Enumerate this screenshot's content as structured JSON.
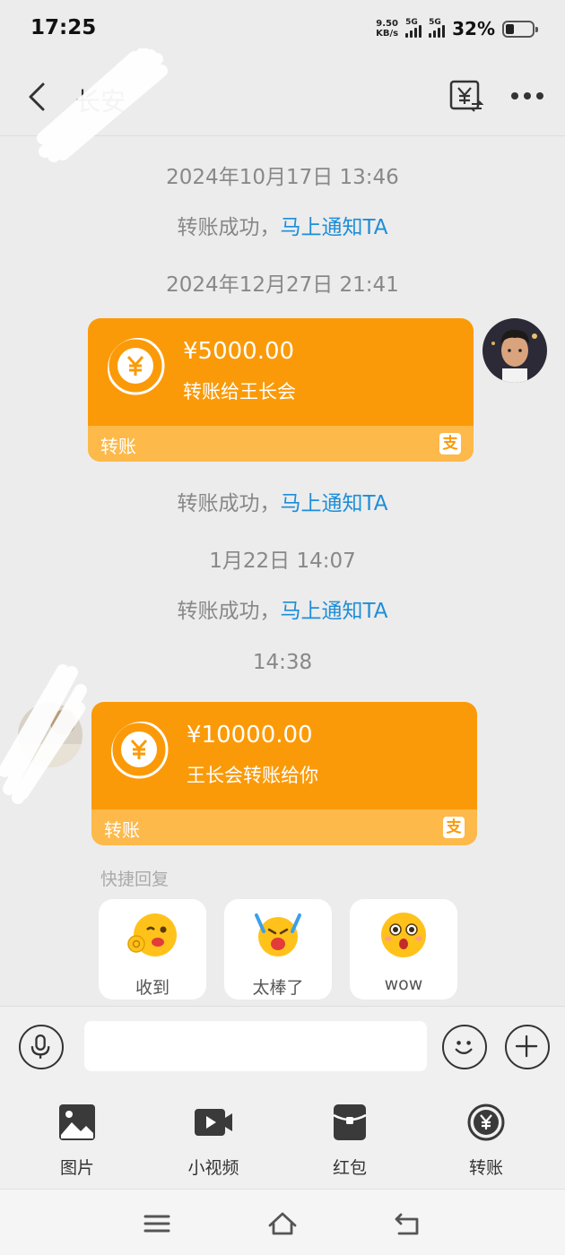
{
  "status_bar": {
    "time": "17:25",
    "net_speed_value": "9.50",
    "net_speed_unit": "KB/s",
    "sim1_label": "5G",
    "sim2_label": "5G",
    "battery_percent": "32%"
  },
  "header": {
    "contact_name": "长安"
  },
  "messages": {
    "ts1": "2024年10月17日 13:46",
    "notice1_text": "转账成功，",
    "notice1_link": "马上通知TA",
    "ts2": "2024年12月27日 21:41",
    "card1": {
      "amount": "¥5000.00",
      "description": "转账给王长会",
      "label": "转账",
      "brand_glyph": "支"
    },
    "notice2_text": "转账成功，",
    "notice2_link": "马上通知TA",
    "ts3": "1月22日 14:07",
    "notice3_text": "转账成功，",
    "notice3_link": "马上通知TA",
    "ts4": "14:38",
    "card2": {
      "amount": "¥10000.00",
      "description": "王长会转账给你",
      "label": "转账",
      "brand_glyph": "支"
    }
  },
  "quick_reply": {
    "title": "快捷回复",
    "items": [
      {
        "label": "收到",
        "icon": "ok-wink-emoji"
      },
      {
        "label": "太棒了",
        "icon": "cheering-emoji"
      },
      {
        "label": "wow",
        "icon": "surprised-emoji"
      }
    ]
  },
  "input": {
    "placeholder": "",
    "value": ""
  },
  "tools": [
    {
      "label": "图片",
      "icon": "image-icon"
    },
    {
      "label": "小视频",
      "icon": "video-icon"
    },
    {
      "label": "红包",
      "icon": "red-packet-icon"
    },
    {
      "label": "转账",
      "icon": "transfer-icon"
    }
  ],
  "colors": {
    "card_orange": "#fb9a08",
    "card_footer": "#fdb94a",
    "link_blue": "#1d8ed8"
  }
}
